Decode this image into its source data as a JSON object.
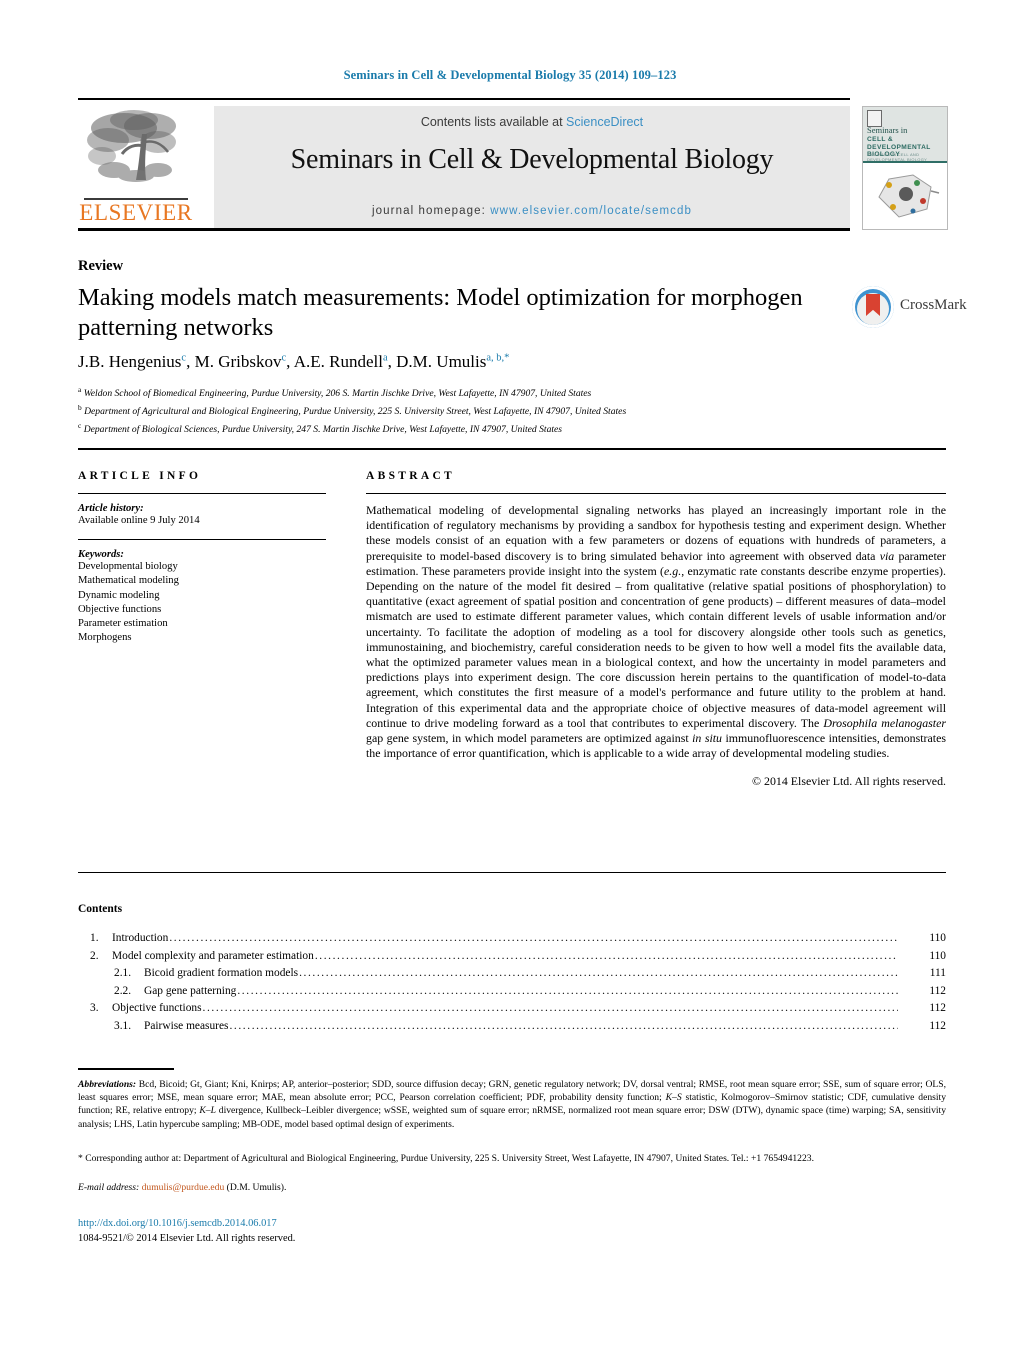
{
  "running_head": "Seminars in Cell & Developmental Biology 35 (2014) 109–123",
  "masthead": {
    "contents_lead": "Contents lists available at ",
    "sciencedirect": "ScienceDirect",
    "journal_title": "Seminars in Cell & Developmental Biology",
    "homepage_label": "journal homepage: ",
    "homepage_url": "www.elsevier.com/locate/semcdb",
    "publisher_wordmark": "ELSEVIER",
    "publisher_color": "#e87722",
    "link_color": "#3b8fc4",
    "cover": {
      "line1": "Seminars in",
      "line2": "CELL & DEVELOPMENTAL BIOLOGY",
      "line3": "SEMINARS IN CELL AND DEVELOPMENTAL BIOLOGY"
    }
  },
  "article": {
    "kicker": "Review",
    "title": "Making models match measurements: Model optimization for morphogen patterning networks",
    "authors_html": "J.B. Hengenius<sup>c</sup>, M. Gribskov<sup>c</sup>, A.E. Rundell<sup>a</sup>, D.M. Umulis<sup>a, b,</sup><sup>*</sup>",
    "affiliations": [
      {
        "mark": "a",
        "text": "Weldon School of Biomedical Engineering, Purdue University, 206 S. Martin Jischke Drive, West Lafayette, IN 47907, United States"
      },
      {
        "mark": "b",
        "text": "Department of Agricultural and Biological Engineering, Purdue University, 225 S. University Street, West Lafayette, IN 47907, United States"
      },
      {
        "mark": "c",
        "text": "Department of Biological Sciences, Purdue University, 247 S. Martin Jischke Drive, West Lafayette, IN 47907, United States"
      }
    ],
    "crossmark_label": "CrossMark"
  },
  "article_info": {
    "heading": "ARTICLE INFO",
    "history_label": "Article history:",
    "history_value": "Available online 9 July 2014",
    "keywords_label": "Keywords:",
    "keywords": [
      "Developmental biology",
      "Mathematical modeling",
      "Dynamic modeling",
      "Objective functions",
      "Parameter estimation",
      "Morphogens"
    ]
  },
  "abstract": {
    "heading": "ABSTRACT",
    "body_html": "Mathematical modeling of developmental signaling networks has played an increasingly important role in the identification of regulatory mechanisms by providing a sandbox for hypothesis testing and experiment design. Whether these models consist of an equation with a few parameters or dozens of equations with hundreds of parameters, a prerequisite to model-based discovery is to bring simulated behavior into agreement with observed data <i>via</i> parameter estimation. These parameters provide insight into the system (<i>e.g.</i>, enzymatic rate constants describe enzyme properties). Depending on the nature of the model fit desired – from qualitative (relative spatial positions of phosphorylation) to quantitative (exact agreement of spatial position and concentration of gene products) – different measures of data–model mismatch are used to estimate different parameter values, which contain different levels of usable information and/or uncertainty. To facilitate the adoption of modeling as a tool for discovery alongside other tools such as genetics, immunostaining, and biochemistry, careful consideration needs to be given to how well a model fits the available data, what the optimized parameter values mean in a biological context, and how the uncertainty in model parameters and predictions plays into experiment design. The core discussion herein pertains to the quantification of model-to-data agreement, which constitutes the first measure of a model's performance and future utility to the problem at hand. Integration of this experimental data and the appropriate choice of objective measures of data-model agreement will continue to drive modeling forward as a tool that contributes to experimental discovery. The <i>Drosophila melanogaster</i> gap gene system, in which model parameters are optimized against <i>in situ</i> immunofluorescence intensities, demonstrates the importance of error quantification, which is applicable to a wide array of developmental modeling studies.",
    "copyright": "© 2014 Elsevier Ltd. All rights reserved."
  },
  "contents": {
    "heading": "Contents",
    "entries": [
      {
        "num": "1.",
        "label": "Introduction",
        "page": "110",
        "sub": false
      },
      {
        "num": "2.",
        "label": "Model complexity and parameter estimation",
        "page": "110",
        "sub": false
      },
      {
        "num": "2.1.",
        "label": "Bicoid gradient formation models",
        "page": "111",
        "sub": true
      },
      {
        "num": "2.2.",
        "label": "Gap gene patterning",
        "page": "112",
        "sub": true
      },
      {
        "num": "3.",
        "label": "Objective functions",
        "page": "112",
        "sub": false
      },
      {
        "num": "3.1.",
        "label": "Pairwise measures",
        "page": "112",
        "sub": true
      }
    ]
  },
  "footnotes": {
    "abbrev_label": "Abbreviations:",
    "abbrev_html": "Bcd, Bicoid; Gt, Giant; Kni, Knirps; AP, anterior–posterior; SDD, source diffusion decay; GRN, genetic regulatory network; DV, dorsal ventral; RMSE, root mean square error; SSE, sum of square error; OLS, least squares error; MSE, mean square error; MAE, mean absolute error; PCC, Pearson correlation coefficient; PDF, probability density function; <i>K–S</i> statistic, Kolmogorov–Smirnov statistic; CDF, cumulative density function; RE, relative entropy; <i>K–L</i> divergence, Kullbeck–Leibler divergence; wSSE, weighted sum of square error; nRMSE, normalized root mean square error; DSW (DTW), dynamic space (time) warping; SA, sensitivity analysis; LHS, Latin hypercube sampling; MB-ODE, model based optimal design of experiments.",
    "corresponding_html": "* Corresponding author at: Department of Agricultural and Biological Engineering, Purdue University, 225 S. University Street, West Lafayette, IN 47907, United States. Tel.: +1 7654941223.",
    "email_label": "E-mail address:",
    "email_address": "dumulis@purdue.edu",
    "email_owner": "(D.M. Umulis).",
    "doi_url": "http://dx.doi.org/10.1016/j.semcdb.2014.06.017",
    "issn_line": "1084-9521/© 2014 Elsevier Ltd. All rights reserved."
  }
}
